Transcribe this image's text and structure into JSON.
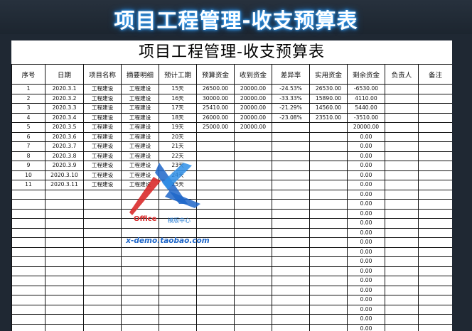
{
  "banner_title": "项目工程管理-收支预算表",
  "sheet_title": "项目工程管理-收支预算表",
  "headers": [
    "序号",
    "日期",
    "项目名称",
    "摘要明细",
    "预计工期",
    "预算资金",
    "收到资金",
    "差异率",
    "实用资金",
    "剩余资金",
    "负责人",
    "备注"
  ],
  "rows": [
    [
      "1",
      "2020.3.1",
      "工程建设",
      "工程建设",
      "15天",
      "26500.00",
      "20000.00",
      "-24.53%",
      "26530.00",
      "-6530.00",
      "",
      ""
    ],
    [
      "2",
      "2020.3.2",
      "工程建设",
      "工程建设",
      "16天",
      "30000.00",
      "20000.00",
      "-33.33%",
      "15890.00",
      "4110.00",
      "",
      ""
    ],
    [
      "3",
      "2020.3.3",
      "工程建设",
      "工程建设",
      "17天",
      "25410.00",
      "20000.00",
      "-21.29%",
      "14560.00",
      "5440.00",
      "",
      ""
    ],
    [
      "4",
      "2020.3.4",
      "工程建设",
      "工程建设",
      "18天",
      "26000.00",
      "20000.00",
      "-23.08%",
      "23510.00",
      "-3510.00",
      "",
      ""
    ],
    [
      "5",
      "2020.3.5",
      "工程建设",
      "工程建设",
      "19天",
      "25000.00",
      "20000.00",
      "",
      "",
      "20000.00",
      "",
      ""
    ],
    [
      "6",
      "2020.3.6",
      "工程建设",
      "工程建设",
      "20天",
      "",
      "",
      "",
      "",
      "0.00",
      "",
      ""
    ],
    [
      "7",
      "2020.3.7",
      "工程建设",
      "工程建设",
      "21天",
      "",
      "",
      "",
      "",
      "0.00",
      "",
      ""
    ],
    [
      "8",
      "2020.3.8",
      "工程建设",
      "工程建设",
      "22天",
      "",
      "",
      "",
      "",
      "0.00",
      "",
      ""
    ],
    [
      "9",
      "2020.3.9",
      "工程建设",
      "工程建设",
      "23天",
      "",
      "",
      "",
      "",
      "0.00",
      "",
      ""
    ],
    [
      "10",
      "2020.3.10",
      "工程建设",
      "工程建设",
      "24天",
      "",
      "",
      "",
      "",
      "0.00",
      "",
      ""
    ],
    [
      "11",
      "2020.3.11",
      "工程建设",
      "工程建设",
      "25天",
      "",
      "",
      "",
      "",
      "0.00",
      "",
      ""
    ],
    [
      "",
      "",
      "",
      "",
      "",
      "",
      "",
      "",
      "",
      "0.00",
      "",
      ""
    ],
    [
      "",
      "",
      "",
      "",
      "",
      "",
      "",
      "",
      "",
      "0.00",
      "",
      ""
    ],
    [
      "",
      "",
      "",
      "",
      "",
      "",
      "",
      "",
      "",
      "0.00",
      "",
      ""
    ],
    [
      "",
      "",
      "",
      "",
      "",
      "",
      "",
      "",
      "",
      "0.00",
      "",
      ""
    ],
    [
      "",
      "",
      "",
      "",
      "",
      "",
      "",
      "",
      "",
      "0.00",
      "",
      ""
    ],
    [
      "",
      "",
      "",
      "",
      "",
      "",
      "",
      "",
      "",
      "0.00",
      "",
      ""
    ],
    [
      "",
      "",
      "",
      "",
      "",
      "",
      "",
      "",
      "",
      "0.00",
      "",
      ""
    ],
    [
      "",
      "",
      "",
      "",
      "",
      "",
      "",
      "",
      "",
      "0.00",
      "",
      ""
    ],
    [
      "",
      "",
      "",
      "",
      "",
      "",
      "",
      "",
      "",
      "0.00",
      "",
      ""
    ],
    [
      "",
      "",
      "",
      "",
      "",
      "",
      "",
      "",
      "",
      "0.00",
      "",
      ""
    ],
    [
      "",
      "",
      "",
      "",
      "",
      "",
      "",
      "",
      "",
      "0.00",
      "",
      ""
    ],
    [
      "",
      "",
      "",
      "",
      "",
      "",
      "",
      "",
      "",
      "0.00",
      "",
      ""
    ],
    [
      "",
      "",
      "",
      "",
      "",
      "",
      "",
      "",
      "",
      "0.00",
      "",
      ""
    ],
    [
      "",
      "",
      "",
      "",
      "",
      "",
      "",
      "",
      "",
      "0.00",
      "",
      ""
    ],
    [
      "",
      "",
      "",
      "",
      "",
      "",
      "",
      "",
      "",
      "0.00",
      "",
      ""
    ],
    [
      "",
      "",
      "",
      "",
      "",
      "",
      "",
      "",
      "",
      "0.00",
      "",
      ""
    ]
  ],
  "watermark": {
    "brand": "Office",
    "sub": "模版中心",
    "url": "x-demo.taobao.com"
  },
  "colors": {
    "background": "#1f2833",
    "title_glow": "#3aa7ff",
    "watermark_red": "#d92b2b",
    "watermark_blue": "#1e66c9"
  }
}
